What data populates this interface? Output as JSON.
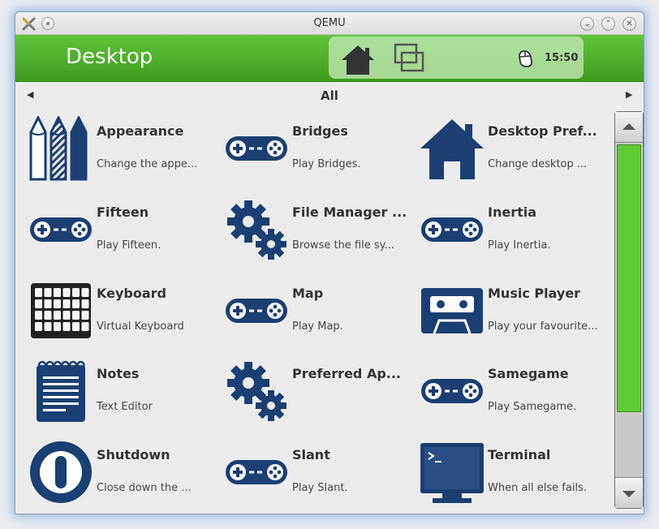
{
  "window": {
    "title": "QEMU"
  },
  "header": {
    "title": "Desktop",
    "clock": "15:50"
  },
  "category": {
    "label": "All"
  },
  "apps": [
    {
      "name": "Appearance",
      "desc": "Change the appe...",
      "icon": "pencils-icon"
    },
    {
      "name": "Bridges",
      "desc": "Play Bridges.",
      "icon": "gamepad-icon"
    },
    {
      "name": "Desktop Pref...",
      "desc": "Change desktop ...",
      "icon": "home-icon"
    },
    {
      "name": "Fifteen",
      "desc": "Play Fifteen.",
      "icon": "gamepad-icon"
    },
    {
      "name": "File Manager ...",
      "desc": "Browse the file sy...",
      "icon": "gears-icon"
    },
    {
      "name": "Inertia",
      "desc": "Play Inertia.",
      "icon": "gamepad-icon"
    },
    {
      "name": "Keyboard",
      "desc": "Virtual Keyboard",
      "icon": "keyboard-icon"
    },
    {
      "name": "Map",
      "desc": "Play Map.",
      "icon": "gamepad-icon"
    },
    {
      "name": "Music Player",
      "desc": "Play your favourite...",
      "icon": "cassette-icon"
    },
    {
      "name": "Notes",
      "desc": "Text Editor",
      "icon": "notepad-icon"
    },
    {
      "name": "Preferred Ap...",
      "desc": "",
      "icon": "gears-icon"
    },
    {
      "name": "Samegame",
      "desc": "Play Samegame.",
      "icon": "gamepad-icon"
    },
    {
      "name": "Shutdown",
      "desc": "Close down the ...",
      "icon": "power-icon"
    },
    {
      "name": "Slant",
      "desc": "Play Slant.",
      "icon": "gamepad-icon"
    },
    {
      "name": "Terminal",
      "desc": "When all else fails.",
      "icon": "terminal-icon"
    }
  ],
  "colors": {
    "accent": "#4caf28",
    "icon": "#1b3f73",
    "scroll_thumb": "#5fcc33"
  }
}
